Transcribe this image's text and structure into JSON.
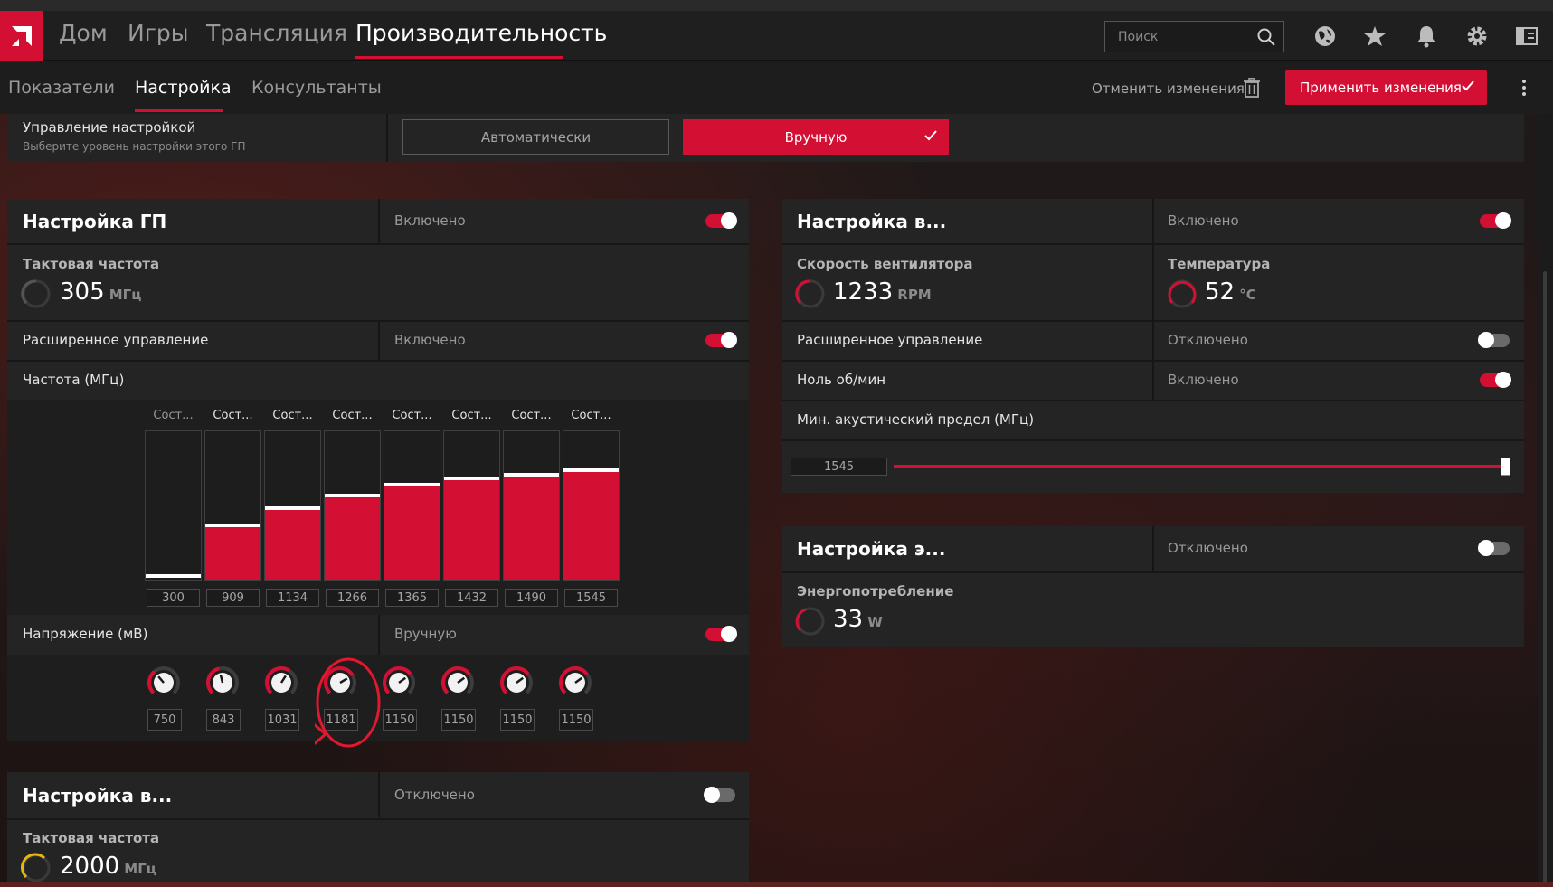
{
  "topnav": {
    "logo": "a",
    "items": [
      "Дом",
      "Игры",
      "Трансляция",
      "Производительность"
    ],
    "active": "Производительность",
    "search_placeholder": "Поиск"
  },
  "subnav": {
    "items": [
      "Показатели",
      "Настройка",
      "Консультанты"
    ],
    "active": "Настройка",
    "discard_label": "Отменить изменения",
    "apply_label": "Применить изменения"
  },
  "tuning_control": {
    "title": "Управление настройкой",
    "subtitle": "Выберите уровень настройки этого ГП",
    "auto_label": "Автоматически",
    "manual_label": "Вручную",
    "selected": "Вручную"
  },
  "gpu_tuning": {
    "title": "Настройка ГП",
    "state": "Включено",
    "enabled": true,
    "clock_label": "Тактовая частота",
    "clock_value": "305",
    "clock_unit": "МГц",
    "advanced_label": "Расширенное управление",
    "advanced_state": "Включено",
    "advanced_enabled": true,
    "freq_label": "Частота (МГц)",
    "state_headers": [
      "Сост...",
      "Сост...",
      "Сост...",
      "Сост...",
      "Сост...",
      "Сост...",
      "Сост...",
      "Сост..."
    ],
    "freq_values": [
      "300",
      "909",
      "1134",
      "1266",
      "1365",
      "1432",
      "1490",
      "1545"
    ],
    "freq_fill": [
      0.0,
      0.36,
      0.47,
      0.56,
      0.63,
      0.67,
      0.7,
      0.73
    ],
    "voltage_label": "Напряжение (мВ)",
    "voltage_state": "Вручную",
    "voltage_enabled": true,
    "voltage_values": [
      "750",
      "843",
      "1031",
      "1181",
      "1150",
      "1150",
      "1150",
      "1150"
    ],
    "voltage_level": [
      0.35,
      0.45,
      0.62,
      0.72,
      0.7,
      0.7,
      0.7,
      0.7
    ]
  },
  "vram_tuning": {
    "title": "Настройка в...",
    "state": "Отключено",
    "enabled": false,
    "clock_label": "Тактовая частота",
    "clock_value": "2000",
    "clock_unit": "МГц"
  },
  "fan_tuning": {
    "title": "Настройка в...",
    "state": "Включено",
    "enabled": true,
    "fan_label": "Скорость вентилятора",
    "fan_value": "1233",
    "fan_unit": "RPM",
    "temp_label": "Температура",
    "temp_value": "52",
    "temp_unit": "°C",
    "advanced_label": "Расширенное управление",
    "advanced_state": "Отключено",
    "advanced_enabled": false,
    "zero_rpm_label": "Ноль об/мин",
    "zero_rpm_state": "Включено",
    "zero_rpm_enabled": true,
    "min_acoustic_label": "Мин. акустический предел (МГц)",
    "min_acoustic_value": "1545",
    "min_acoustic_level": 1.0
  },
  "power_tuning": {
    "title": "Настройка э...",
    "state": "Отключено",
    "enabled": false,
    "power_label": "Энергопотребление",
    "power_value": "33",
    "power_unit": "W"
  },
  "colors": {
    "accent": "#d40f34",
    "panel": "#242424",
    "annotation": "#e0192f",
    "gauge_yellow": "#e8b70f"
  }
}
